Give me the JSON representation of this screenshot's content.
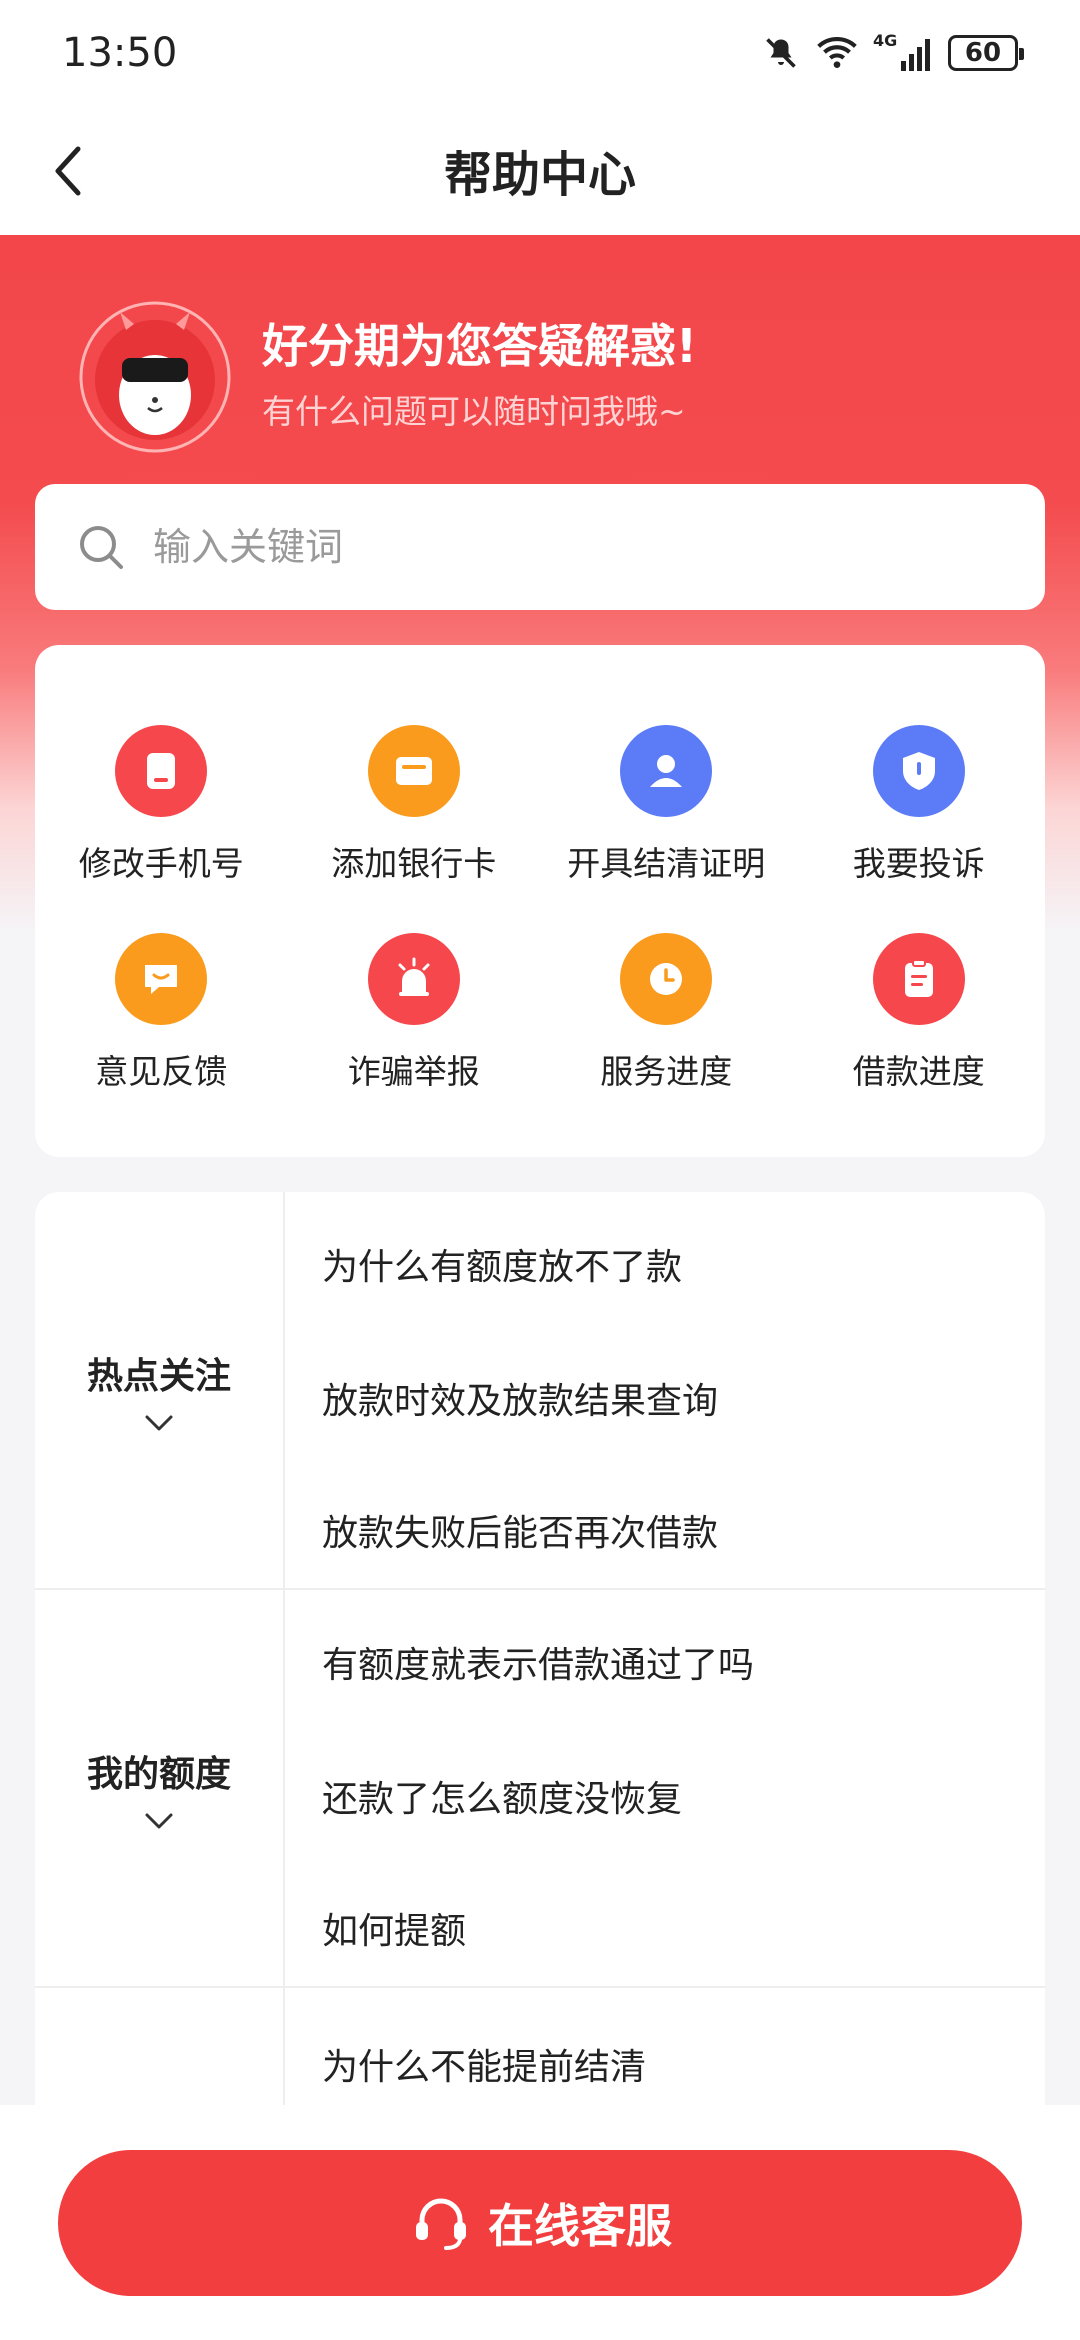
{
  "status_bar": {
    "time": "13:50",
    "network": "4G",
    "battery": "60"
  },
  "header": {
    "title": "帮助中心"
  },
  "banner": {
    "title": "好分期为您答疑解惑!",
    "subtitle": "有什么问题可以随时问我哦~"
  },
  "search": {
    "placeholder": "输入关键词"
  },
  "quick_actions": [
    {
      "label": "修改手机号",
      "icon": "phone-icon",
      "color": "#f5474c"
    },
    {
      "label": "添加银行卡",
      "icon": "bank-card-icon",
      "color": "#fa9b1e"
    },
    {
      "label": "开具结清证明",
      "icon": "person-certificate-icon",
      "color": "#5c7cf7"
    },
    {
      "label": "我要投诉",
      "icon": "shield-icon",
      "color": "#5c7cf7"
    },
    {
      "label": "意见反馈",
      "icon": "message-icon",
      "color": "#fa9b1e"
    },
    {
      "label": "诈骗举报",
      "icon": "alarm-icon",
      "color": "#f5474c"
    },
    {
      "label": "服务进度",
      "icon": "clock-icon",
      "color": "#fa9b1e"
    },
    {
      "label": "借款进度",
      "icon": "clipboard-icon",
      "color": "#f5474c"
    }
  ],
  "faq": [
    {
      "category": "热点关注",
      "questions": [
        "为什么有额度放不了款",
        "放款时效及放款结果查询",
        "放款失败后能否再次借款"
      ]
    },
    {
      "category": "我的额度",
      "questions": [
        "有额度就表示借款通过了吗",
        "还款了怎么额度没恢复",
        "如何提额"
      ]
    },
    {
      "category": "",
      "questions": [
        "为什么不能提前结清"
      ]
    }
  ],
  "footer": {
    "service_label": "在线客服"
  },
  "colors": {
    "brand_red": "#f23e3e",
    "orange": "#fa9b1e",
    "blue": "#5c7cf7"
  }
}
